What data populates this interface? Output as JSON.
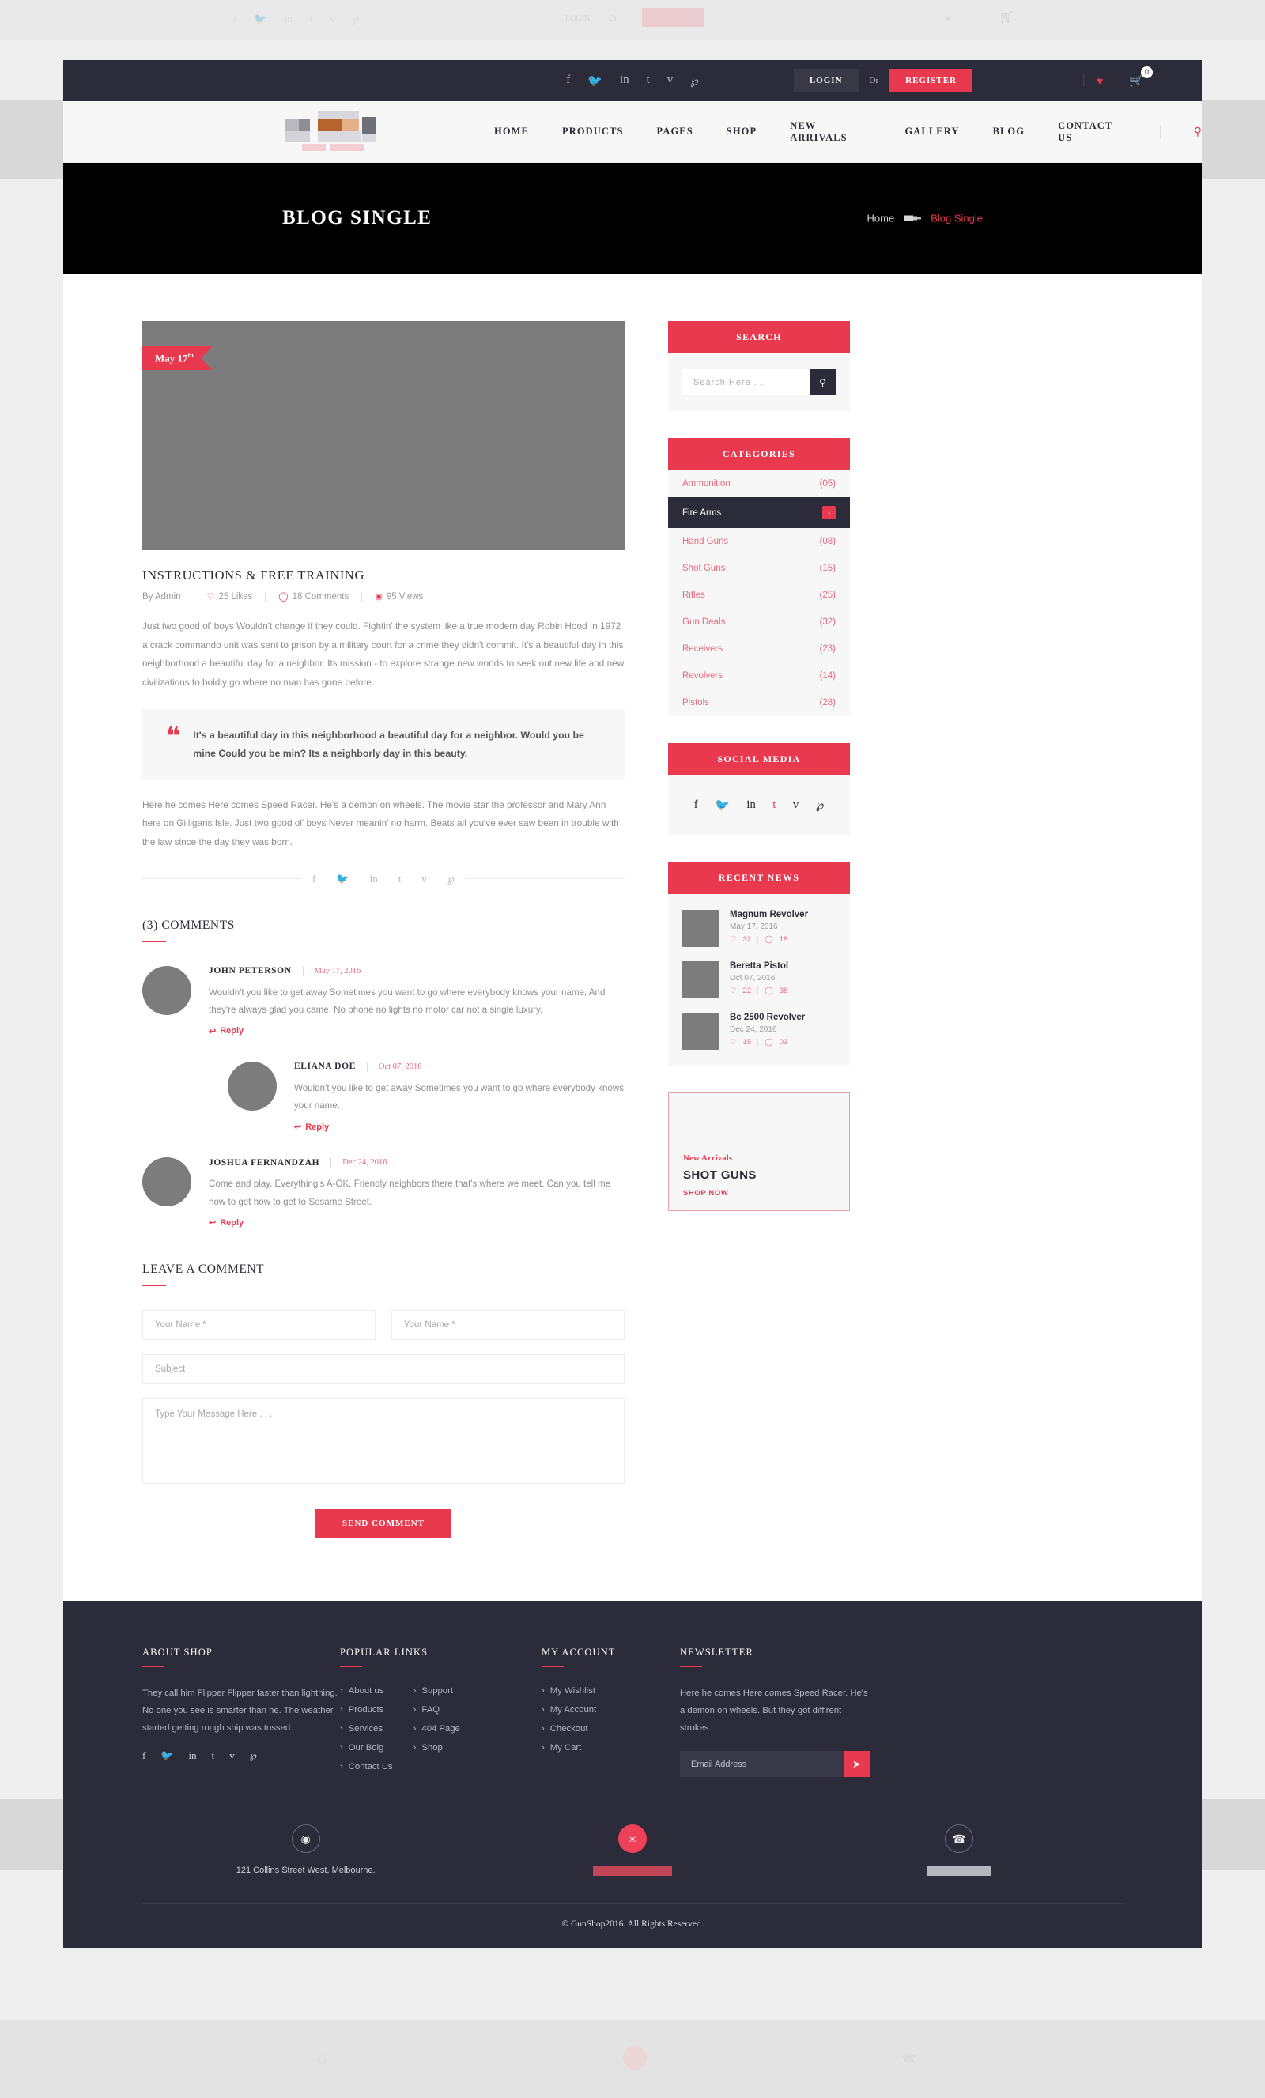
{
  "topbar": {
    "socials": [
      "f",
      "🐦",
      "in",
      "t",
      "v",
      "℘"
    ],
    "login_label": "LOGIN",
    "or_label": "Or",
    "register_label": "REGISTER",
    "wishlist_icon": "heart-icon",
    "cart_icon": "cart-icon",
    "cart_count": "0"
  },
  "nav": {
    "items": [
      "HOME",
      "PRODUCTS",
      "PAGES",
      "SHOP",
      "NEW ARRIVALS",
      "GALLERY",
      "BLOG",
      "CONTACT US"
    ],
    "search_icon": "search-icon"
  },
  "banner": {
    "title": "BLOG SINGLE",
    "crumb_home": "Home",
    "crumb_current": "Blog Single"
  },
  "post": {
    "date_badge": "May 17",
    "date_badge_sup": "th",
    "title": "INSTRUCTIONS & FREE TRAINING",
    "meta": {
      "author": "By Admin",
      "likes": "25 Likes",
      "comments": "18 Comments",
      "views": "95 Views"
    },
    "paragraph_1": "Just two good ol' boys Wouldn't change if they could. Fightin' the system like a true modern day Robin Hood In 1972 a crack commando unit was sent to prison by a military court for a crime they didn't commit. It's a beautiful day in this neighborhood a beautiful day for a neighbor. Its mission - to explore strange new worlds to seek out new life and new civilizations to boldly go where no man has gone before.",
    "quote": "It's a beautiful day in this neighborhood a beautiful day for a neighbor. Would you be mine Could you be min? Its a neighborly day in this beauty.",
    "paragraph_2": "Here he comes Here comes Speed Racer. He's a demon on wheels. The movie star the professor and Mary Ann here on Gilligans Isle. Just two good ol' boys Never meanin' no harm. Beats all you've ever saw been in trouble with the law since the day they was born.",
    "share_icons": [
      "f",
      "🐦",
      "in",
      "t",
      "v",
      "℘"
    ]
  },
  "comments_section": {
    "heading": "(3) COMMENTS",
    "reply_label": "Reply",
    "items": [
      {
        "name": "JOHN PETERSON",
        "date": "May 17, 2016",
        "text": "Wouldn't you like to get away Sometimes you want to go where everybody knows your name. And they're always glad you came. No phone no lights no motor car not a single luxury.",
        "nested": false
      },
      {
        "name": "ELIANA DOE",
        "date": "Oct 07, 2016",
        "text": "Wouldn't you like to get away Sometimes you want to go where everybody knows your name.",
        "nested": true
      },
      {
        "name": "JOSHUA FERNANDZAH",
        "date": "Dec 24, 2016",
        "text": "Come and play. Everything's A-OK. Friendly neighbors there that's where we meet. Can you tell me how to get how to get to Sesame Street.",
        "nested": false
      }
    ]
  },
  "comment_form": {
    "heading": "LEAVE A COMMENT",
    "name_placeholder": "Your Name *",
    "email_placeholder": "Your Name *",
    "subject_placeholder": "Subject",
    "message_placeholder": "Type Your Message Here . . .",
    "submit_label": "SEND COMMENT"
  },
  "sidebar": {
    "search": {
      "title": "SEARCH",
      "placeholder": "Search Here . . .",
      "icon": "search-icon"
    },
    "categories": {
      "title": "CATEGORIES",
      "items": [
        {
          "label": "Ammunition",
          "count": "(05)",
          "active": false
        },
        {
          "label": "Fire Arms",
          "count": "",
          "active": true
        },
        {
          "label": "Hand Guns",
          "count": "(08)",
          "active": false
        },
        {
          "label": "Shot Guns",
          "count": "(15)",
          "active": false
        },
        {
          "label": "Rifles",
          "count": "(25)",
          "active": false
        },
        {
          "label": "Gun Deals",
          "count": "(32)",
          "active": false
        },
        {
          "label": "Receivers",
          "count": "(23)",
          "active": false
        },
        {
          "label": "Revolvers",
          "count": "(14)",
          "active": false
        },
        {
          "label": "Pistols",
          "count": "(28)",
          "active": false
        }
      ]
    },
    "social": {
      "title": "SOCIAL MEDIA",
      "icons": [
        "f",
        "🐦",
        "in",
        "t",
        "v",
        "℘"
      ]
    },
    "recent_news": {
      "title": "RECENT NEWS",
      "items": [
        {
          "title": "Magnum Revolver",
          "date": "May 17, 2016",
          "likes": "32",
          "comments": "18"
        },
        {
          "title": "Beretta Pistol",
          "date": "Oct 07, 2016",
          "likes": "22",
          "comments": "38"
        },
        {
          "title": "Bc 2500 Revolver",
          "date": "Dec 24, 2016",
          "likes": "15",
          "comments": "03"
        }
      ]
    },
    "promo": {
      "kicker": "New Arrivals",
      "title": "SHOT GUNS",
      "cta": "SHOP NOW"
    }
  },
  "footer": {
    "about": {
      "heading": "ABOUT SHOP",
      "text": "They call him Flipper Flipper faster than lightning. No one you see is smarter than he. The weather started getting rough ship was tossed.",
      "socials": [
        "f",
        "🐦",
        "in",
        "t",
        "v",
        "℘"
      ]
    },
    "popular": {
      "heading": "POPULAR LINKS",
      "col1": [
        "About us",
        "Products",
        "Services",
        "Our Bolg",
        "Contact Us"
      ],
      "col2": [
        "Support",
        "FAQ",
        "404 Page",
        "Shop"
      ]
    },
    "account": {
      "heading": "MY ACCOUNT",
      "items": [
        "My Wishlist",
        "My Account",
        "Checkout",
        "My Cart"
      ]
    },
    "newsletter": {
      "heading": "NEWSLETTER",
      "text": "Here he comes Here comes Speed Racer. He's a demon on wheels. But they got diff'rent strokes.",
      "placeholder": "Email Address",
      "send_icon": "paper-plane-icon"
    },
    "contact": {
      "address": "121 Collins Street West, Melbourne.",
      "email_redacted": "",
      "phone_redacted": ""
    },
    "copyright": "© GunShop2016. All Rights Reserved."
  },
  "colors": {
    "accent": "#e8394f",
    "dark": "#2b2b39",
    "light_bg": "#f7f7f7"
  }
}
